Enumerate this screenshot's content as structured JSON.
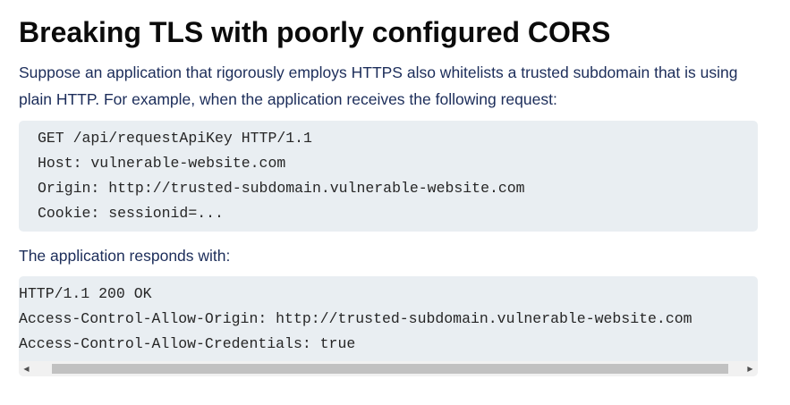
{
  "heading": "Breaking TLS with poorly configured CORS",
  "intro": "Suppose an application that rigorously employs HTTPS also whitelists a trusted subdomain that is using plain HTTP. For example, when the application receives the following request:",
  "request_lines": [
    "GET /api/requestApiKey HTTP/1.1",
    "Host: vulnerable-website.com",
    "Origin: http://trusted-subdomain.vulnerable-website.com",
    "Cookie: sessionid=..."
  ],
  "response_intro": "The application responds with:",
  "response_lines": [
    "HTTP/1.1 200 OK",
    "Access-Control-Allow-Origin: http://trusted-subdomain.vulnerable-website.com",
    "Access-Control-Allow-Credentials: true"
  ],
  "scrollbar": {
    "left_arrow": "◀",
    "right_arrow": "▶"
  }
}
